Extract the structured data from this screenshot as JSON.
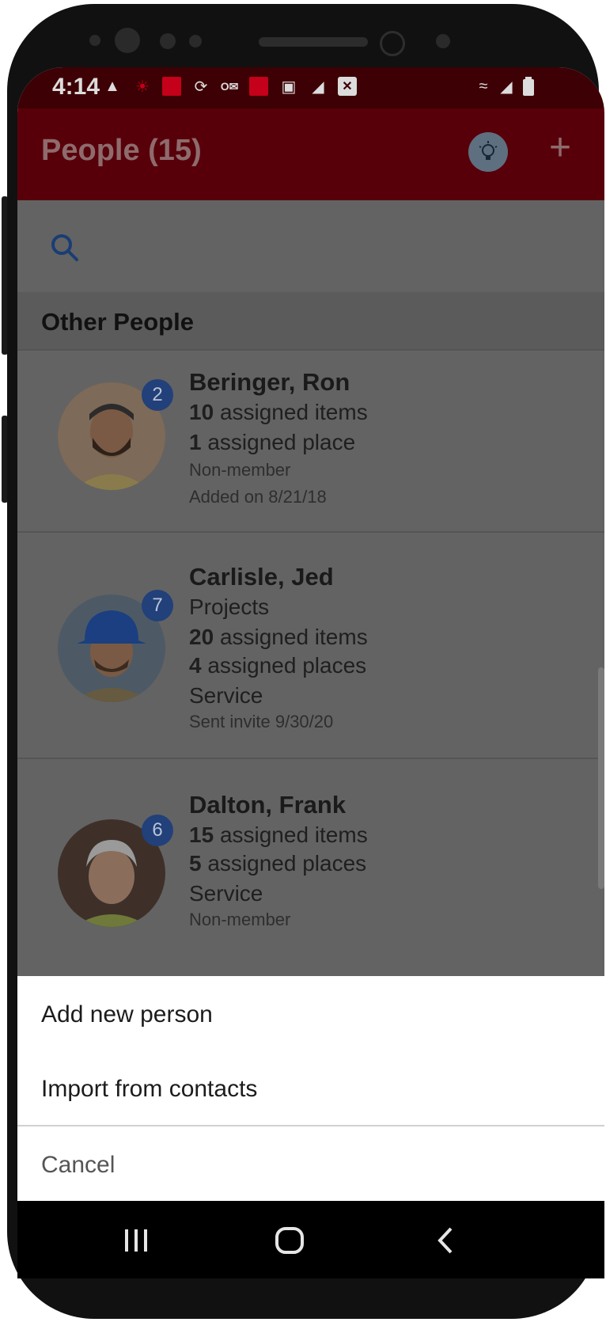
{
  "status_bar": {
    "time": "4:14",
    "icons": [
      "warning-icon",
      "sun-alert-icon",
      "app-red-icon",
      "sync-icon",
      "outlook-icon",
      "app-red-icon",
      "image-icon",
      "no-signal-chart-icon",
      "close-box-icon"
    ],
    "right_icons": [
      "wifi-icon",
      "cell-signal-icon",
      "battery-icon"
    ]
  },
  "app_bar": {
    "title": "People (15)",
    "bulb_icon": "lightbulb-icon",
    "add_icon": "plus-icon"
  },
  "search": {
    "icon": "search-icon",
    "value": ""
  },
  "section": {
    "title": "Other People"
  },
  "people": [
    {
      "name": "Beringer, Ron",
      "badge": "2",
      "items_count": "10",
      "items_label": "assigned items",
      "places_count": "1",
      "places_label": "assigned place",
      "status": "Non-member",
      "date": "Added on 8/21/18"
    },
    {
      "name": "Carlisle, Jed",
      "badge": "7",
      "group": "Projects",
      "items_count": "20",
      "items_label": "assigned items",
      "places_count": "4",
      "places_label": "assigned places",
      "role": "Service",
      "date": "Sent invite 9/30/20"
    },
    {
      "name": "Dalton, Frank",
      "badge": "6",
      "items_count": "15",
      "items_label": "assigned items",
      "places_count": "5",
      "places_label": "assigned places",
      "role": "Service",
      "status": "Non-member"
    }
  ],
  "action_sheet": {
    "add_new": "Add new person",
    "import": "Import from contacts",
    "cancel": "Cancel"
  },
  "colors": {
    "app_bar": "#58000a",
    "status_bar": "#3d0004",
    "badge": "#22407a",
    "overlay_content": "#636363"
  }
}
